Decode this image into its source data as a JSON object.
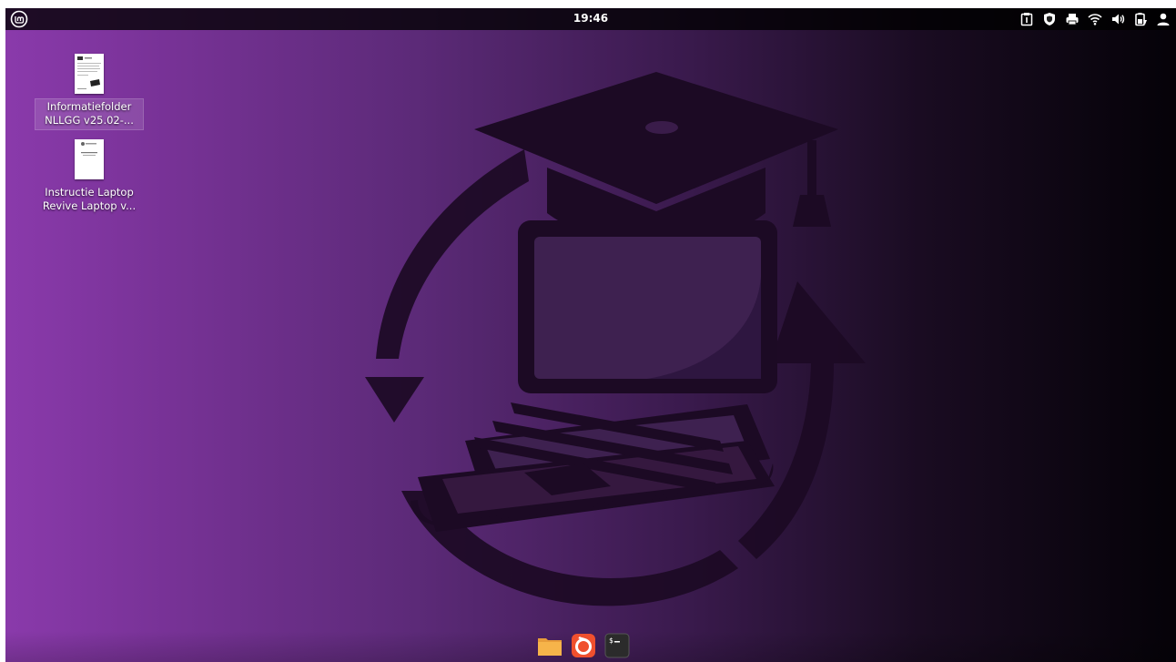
{
  "top_panel": {
    "clock": "19:46",
    "menu_icon": "linux-mint-logo-icon",
    "tray_icons": [
      "clipboard-icon",
      "shield-icon",
      "printer-icon",
      "wifi-icon",
      "volume-icon",
      "battery-icon",
      "user-icon"
    ]
  },
  "desktop": {
    "icons": [
      {
        "label_line1": "Informatiefolder",
        "label_line2": "NLLGG v25.02-...",
        "icon": "pdf-document-icon",
        "selected": true
      },
      {
        "label_line1": "Instructie Laptop",
        "label_line2": "Revive Laptop v...",
        "icon": "pdf-document-icon",
        "selected": false
      }
    ]
  },
  "wallpaper": {
    "icon": "graduation-cap-laptop-recycle-logo",
    "gradient_colors": [
      "#8a3aab",
      "#5c2a78",
      "#1a0c22",
      "#050208"
    ]
  },
  "dock": {
    "items": [
      {
        "name": "files",
        "icon": "folder-icon",
        "color": "#f6b44a"
      },
      {
        "name": "firefox",
        "icon": "firefox-icon",
        "color": "#f0502e"
      },
      {
        "name": "terminal",
        "icon": "terminal-icon",
        "color": "#2b2b2b"
      }
    ]
  }
}
